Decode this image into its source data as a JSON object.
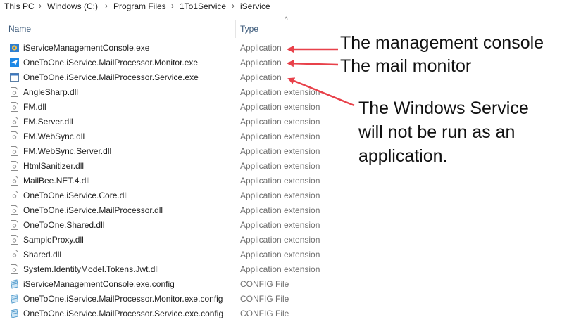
{
  "breadcrumb": [
    "This PC",
    "Windows (C:)",
    "Program Files",
    "1To1Service",
    "iService"
  ],
  "columns": {
    "name": "Name",
    "type": "Type"
  },
  "files": [
    {
      "name": "iServiceManagementConsole.exe",
      "type": "Application",
      "icon": "gear-app-icon"
    },
    {
      "name": "OneToOne.iService.MailProcessor.Monitor.exe",
      "type": "Application",
      "icon": "paper-plane-app-icon"
    },
    {
      "name": "OneToOne.iService.MailProcessor.Service.exe",
      "type": "Application",
      "icon": "window-app-icon"
    },
    {
      "name": "AngleSharp.dll",
      "type": "Application extension",
      "icon": "dll-icon"
    },
    {
      "name": "FM.dll",
      "type": "Application extension",
      "icon": "dll-icon"
    },
    {
      "name": "FM.Server.dll",
      "type": "Application extension",
      "icon": "dll-icon"
    },
    {
      "name": "FM.WebSync.dll",
      "type": "Application extension",
      "icon": "dll-icon"
    },
    {
      "name": "FM.WebSync.Server.dll",
      "type": "Application extension",
      "icon": "dll-icon"
    },
    {
      "name": "HtmlSanitizer.dll",
      "type": "Application extension",
      "icon": "dll-icon"
    },
    {
      "name": "MailBee.NET.4.dll",
      "type": "Application extension",
      "icon": "dll-icon"
    },
    {
      "name": "OneToOne.iService.Core.dll",
      "type": "Application extension",
      "icon": "dll-icon"
    },
    {
      "name": "OneToOne.iService.MailProcessor.dll",
      "type": "Application extension",
      "icon": "dll-icon"
    },
    {
      "name": "OneToOne.Shared.dll",
      "type": "Application extension",
      "icon": "dll-icon"
    },
    {
      "name": "SampleProxy.dll",
      "type": "Application extension",
      "icon": "dll-icon"
    },
    {
      "name": "Shared.dll",
      "type": "Application extension",
      "icon": "dll-icon"
    },
    {
      "name": "System.IdentityModel.Tokens.Jwt.dll",
      "type": "Application extension",
      "icon": "dll-icon"
    },
    {
      "name": "iServiceManagementConsole.exe.config",
      "type": "CONFIG File",
      "icon": "config-icon"
    },
    {
      "name": "OneToOne.iService.MailProcessor.Monitor.exe.config",
      "type": "CONFIG File",
      "icon": "config-icon"
    },
    {
      "name": "OneToOne.iService.MailProcessor.Service.exe.config",
      "type": "CONFIG File",
      "icon": "config-icon"
    }
  ],
  "annotations": {
    "console": "The management console",
    "monitor": "The mail monitor",
    "service_lines": [
      "The Windows Service",
      "will not be run as an",
      "application."
    ]
  },
  "colors": {
    "arrow": "#e8414a",
    "header_text": "#3c5a7a",
    "type_text": "#6d6d6d"
  }
}
